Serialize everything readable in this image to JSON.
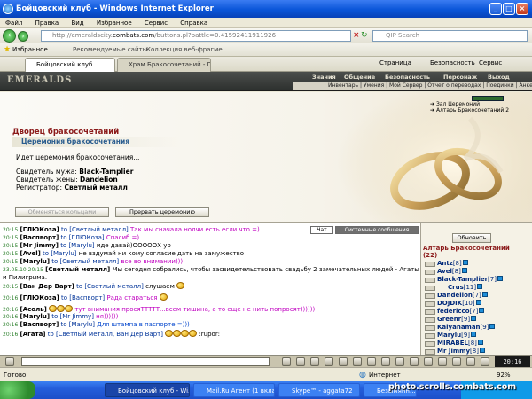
{
  "window": {
    "title": "Бойцовский клуб - Windows Internet Explorer"
  },
  "menu": [
    "Файл",
    "Правка",
    "Вид",
    "Избранное",
    "Сервис",
    "Справка"
  ],
  "address": {
    "prefix": "http://emeraldscity.",
    "domain": "combats.com",
    "path": "/buttons.pl?battle=0.41592411911926",
    "search_placeholder": "QIP Search"
  },
  "favorites_bar": {
    "favorites": "Избранное",
    "recommended": "Рекомендуемые сайты",
    "gallery": "Коллекция веб-фрагме..."
  },
  "tabs": [
    "Бойцовский клуб",
    "Храм Бракосочетаний - Dar..."
  ],
  "command_bar": {
    "page": "Страница",
    "security": "Безопасность",
    "service": "Сервис"
  },
  "game": {
    "logo": "EMERALDS",
    "topnav": [
      "Знания",
      "Общение",
      "Безопасность",
      "Персонаж",
      "Выход"
    ],
    "subnav": "Инвентарь | Умения | Мой Сервер | Отчет о переводах | Поединки | Анкета",
    "rooms": [
      "Зал Церемоний",
      "Алтарь Бракосочетаний 2"
    ],
    "palace_title": "Дворец бракосочетаний",
    "ceremony_title": "Церемония бракосочетания",
    "status": "Идет церемония бракосочетания...",
    "groom_witness_label": "Свидетель мужа:",
    "groom_witness": "Black-Tamplier",
    "bride_witness_label": "Свидетель жены:",
    "bride_witness": "Dandelion",
    "registrar_label": "Регистратор:",
    "registrar": "Светлый металл",
    "btn_exchange": "Обменяться кольцами",
    "btn_interrupt": "Прервать церемонию"
  },
  "chat": {
    "tab_chat": "Чат",
    "tab_system": "Системные сообщения",
    "messages": [
      {
        "time": "20:15",
        "nick": "[ГЛЮКоза]",
        "prep": "to",
        "to": "[Светлый металл]",
        "text": "Так мы сначала нолчи есть если что =)",
        "color": "mag"
      },
      {
        "time": "20:15",
        "nick": "[Васпворт]",
        "prep": "to",
        "to": "[ГЛЮКоза]",
        "text": "Спасиб =)",
        "color": "mag"
      },
      {
        "time": "20:15",
        "nick": "[Mr Jimmy]",
        "prep": "to",
        "to": "[Marylu]",
        "text": "иде давай)ОООООХ ур",
        "color": ""
      },
      {
        "time": "20:15",
        "nick": "[Avel]",
        "prep": "to",
        "to": "[Marylu]",
        "text": "не вздумай ни кому согласие дать на замужество",
        "color": ""
      },
      {
        "time": "20:15",
        "nick": "[Marylu]",
        "prep": "to",
        "to": "[Светлый металл]",
        "text": "все во внимании)))",
        "color": "mag"
      },
      {
        "time": "23.05.10 20:15",
        "nick": "[Светлый металл]",
        "prep": "",
        "to": "",
        "text": "Мы сегодня собрались, чтобы засвидетельствовать свадьбу 2 замечательных людей - Агаты и Пилигрима.",
        "color": ""
      },
      {
        "time": "20:15",
        "nick": "[Ван Дер Варт]",
        "prep": "to",
        "to": "[Светлый металл]",
        "text": "слушаем",
        "color": ""
      },
      {
        "time": "20:16",
        "nick": "[ГЛЮКоза]",
        "prep": "to",
        "to": "[Васпворт]",
        "text": "Рада стараться",
        "color": "mag"
      },
      {
        "time": "20:16",
        "nick": "[Асоль]",
        "prep": "",
        "to": "",
        "text": "тут внимания просяТТТТТ...всем тишина, а то еще не нить попросят))))))",
        "color": "mag"
      },
      {
        "time": "20:16",
        "nick": "[Marylu]",
        "prep": "to",
        "to": "[Mr Jimmy]",
        "text": "ня))))))",
        "color": "mag"
      },
      {
        "time": "20:16",
        "nick": "[Васпворт]",
        "prep": "to",
        "to": "[Marylu]",
        "text": "Для штампа в паспорте =)))",
        "color": "blue"
      },
      {
        "time": "20:16",
        "nick": "[Агата]",
        "prep": "to",
        "to": "[Светлый металл, Ван Дер Варт]",
        "text": ":rupor:",
        "color": ""
      }
    ]
  },
  "online": {
    "refresh": "Обновить",
    "title": "Алтарь Бракосочетаний",
    "count": "(22)",
    "users": [
      {
        "nick": "Antz",
        "level": "[8]"
      },
      {
        "nick": "Avel",
        "level": "[8]"
      },
      {
        "nick": "Black-Tamplier",
        "level": "[7]"
      },
      {
        "nick": "Crus",
        "level": "[11]"
      },
      {
        "nick": "Dandelion",
        "level": "[7]"
      },
      {
        "nick": "DOJDIK",
        "level": "[10]"
      },
      {
        "nick": "federicco",
        "level": "[7]"
      },
      {
        "nick": "Greenr",
        "level": "[9]"
      },
      {
        "nick": "Kalyanaman",
        "level": "[9]"
      },
      {
        "nick": "Marylu",
        "level": "[9]"
      },
      {
        "nick": "MIRABEL",
        "level": "[8]"
      },
      {
        "nick": "Mr Jimmy",
        "level": "[8]"
      }
    ]
  },
  "game_clock": "20:16",
  "statusbar": {
    "left": "Готово",
    "zone": "Интернет",
    "zoom": "92%"
  },
  "taskbar": [
    "Бойцовский клуб - Wi...",
    "Mail.Ru Агент (1 вкла...",
    "Skype™ - aggata72",
    "Безымянн..."
  ],
  "watermark": "photo.scrolls.combats.com"
}
